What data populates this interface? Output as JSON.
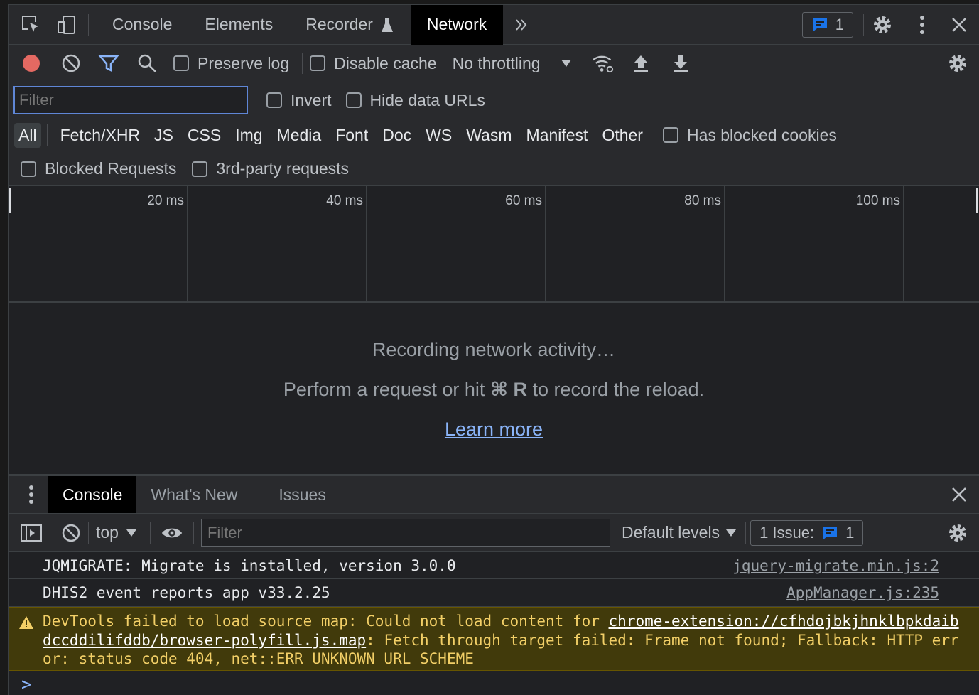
{
  "tabs": {
    "items": [
      {
        "label": "Console"
      },
      {
        "label": "Elements"
      },
      {
        "label": "Recorder"
      },
      {
        "label": "Network",
        "active": true
      }
    ],
    "issues_count": "1"
  },
  "toolbar": {
    "preserve_log": "Preserve log",
    "disable_cache": "Disable cache",
    "throttling": "No throttling"
  },
  "filter": {
    "placeholder": "Filter",
    "invert": "Invert",
    "hide_data_urls": "Hide data URLs"
  },
  "types": [
    "All",
    "Fetch/XHR",
    "JS",
    "CSS",
    "Img",
    "Media",
    "Font",
    "Doc",
    "WS",
    "Wasm",
    "Manifest",
    "Other"
  ],
  "has_blocked_cookies": "Has blocked cookies",
  "blocked_requests": "Blocked Requests",
  "third_party": "3rd-party requests",
  "timeline": {
    "ticks": [
      "20 ms",
      "40 ms",
      "60 ms",
      "80 ms",
      "100 ms"
    ]
  },
  "empty_state": {
    "line1": "Recording network activity…",
    "line2_pre": "Perform a request or hit",
    "line2_key": "⌘ R",
    "line2_post": "to record the reload.",
    "learn_more": "Learn more"
  },
  "drawer": {
    "tabs": [
      {
        "label": "Console",
        "active": true
      },
      {
        "label": "What's New"
      },
      {
        "label": "Issues"
      }
    ],
    "context": "top",
    "filter_placeholder": "Filter",
    "levels": "Default levels",
    "issues_label": "1 Issue:",
    "issues_count": "1"
  },
  "console": {
    "messages": [
      {
        "text": "JQMIGRATE: Migrate is installed, version 3.0.0",
        "source": "jquery-migrate.min.js:2"
      },
      {
        "text": "DHIS2 event reports app v33.2.25",
        "source": "AppManager.js:235"
      }
    ],
    "warning": {
      "pre": "DevTools failed to load source map: Could not load content for ",
      "link": "chrome-extension://cfhdojbkjhnklbpkdaibdccddilifddb/browser-polyfill.js.map",
      "post": ": Fetch through target failed: Frame not found; Fallback: HTTP error: status code 404, net::ERR_UNKNOWN_URL_SCHEME"
    },
    "prompt": ">"
  },
  "colors": {
    "record": "#e46962",
    "accent": "#8ab4f8",
    "warning_bg": "#413a0b",
    "warning_text": "#f2cf67"
  }
}
